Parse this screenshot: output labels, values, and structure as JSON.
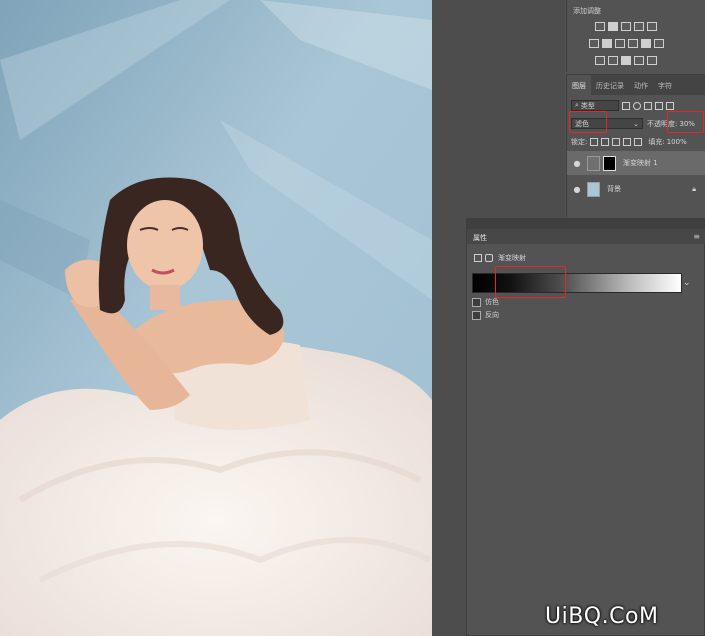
{
  "adjust_panel": {
    "title": "添加调整"
  },
  "layers_panel": {
    "tabs": [
      {
        "label": "图层",
        "active": true
      },
      {
        "label": "历史记录",
        "active": false
      },
      {
        "label": "动作",
        "active": false
      },
      {
        "label": "字符",
        "active": false
      }
    ],
    "filter_kind": "类型",
    "blend_mode": "滤色",
    "opacity_label": "不透明度:",
    "opacity_value": "30%",
    "lock_label": "锁定:",
    "fill_label": "填充:",
    "fill_value": "100%",
    "layers": [
      {
        "name": "渐变映射 1",
        "selected": true
      },
      {
        "name": "背景",
        "selected": false
      }
    ]
  },
  "properties_panel": {
    "tab": "属性",
    "header_label": "渐变映射",
    "options": [
      {
        "label": "仿色",
        "checked": false
      },
      {
        "label": "反向",
        "checked": false
      }
    ]
  },
  "watermark": "UiBQ.CoM",
  "colors": {
    "panel_bg": "#535353",
    "highlight_red": "#e0292c",
    "sky_blue": "#8fb2c6",
    "dress_white": "#f3ebe6"
  }
}
